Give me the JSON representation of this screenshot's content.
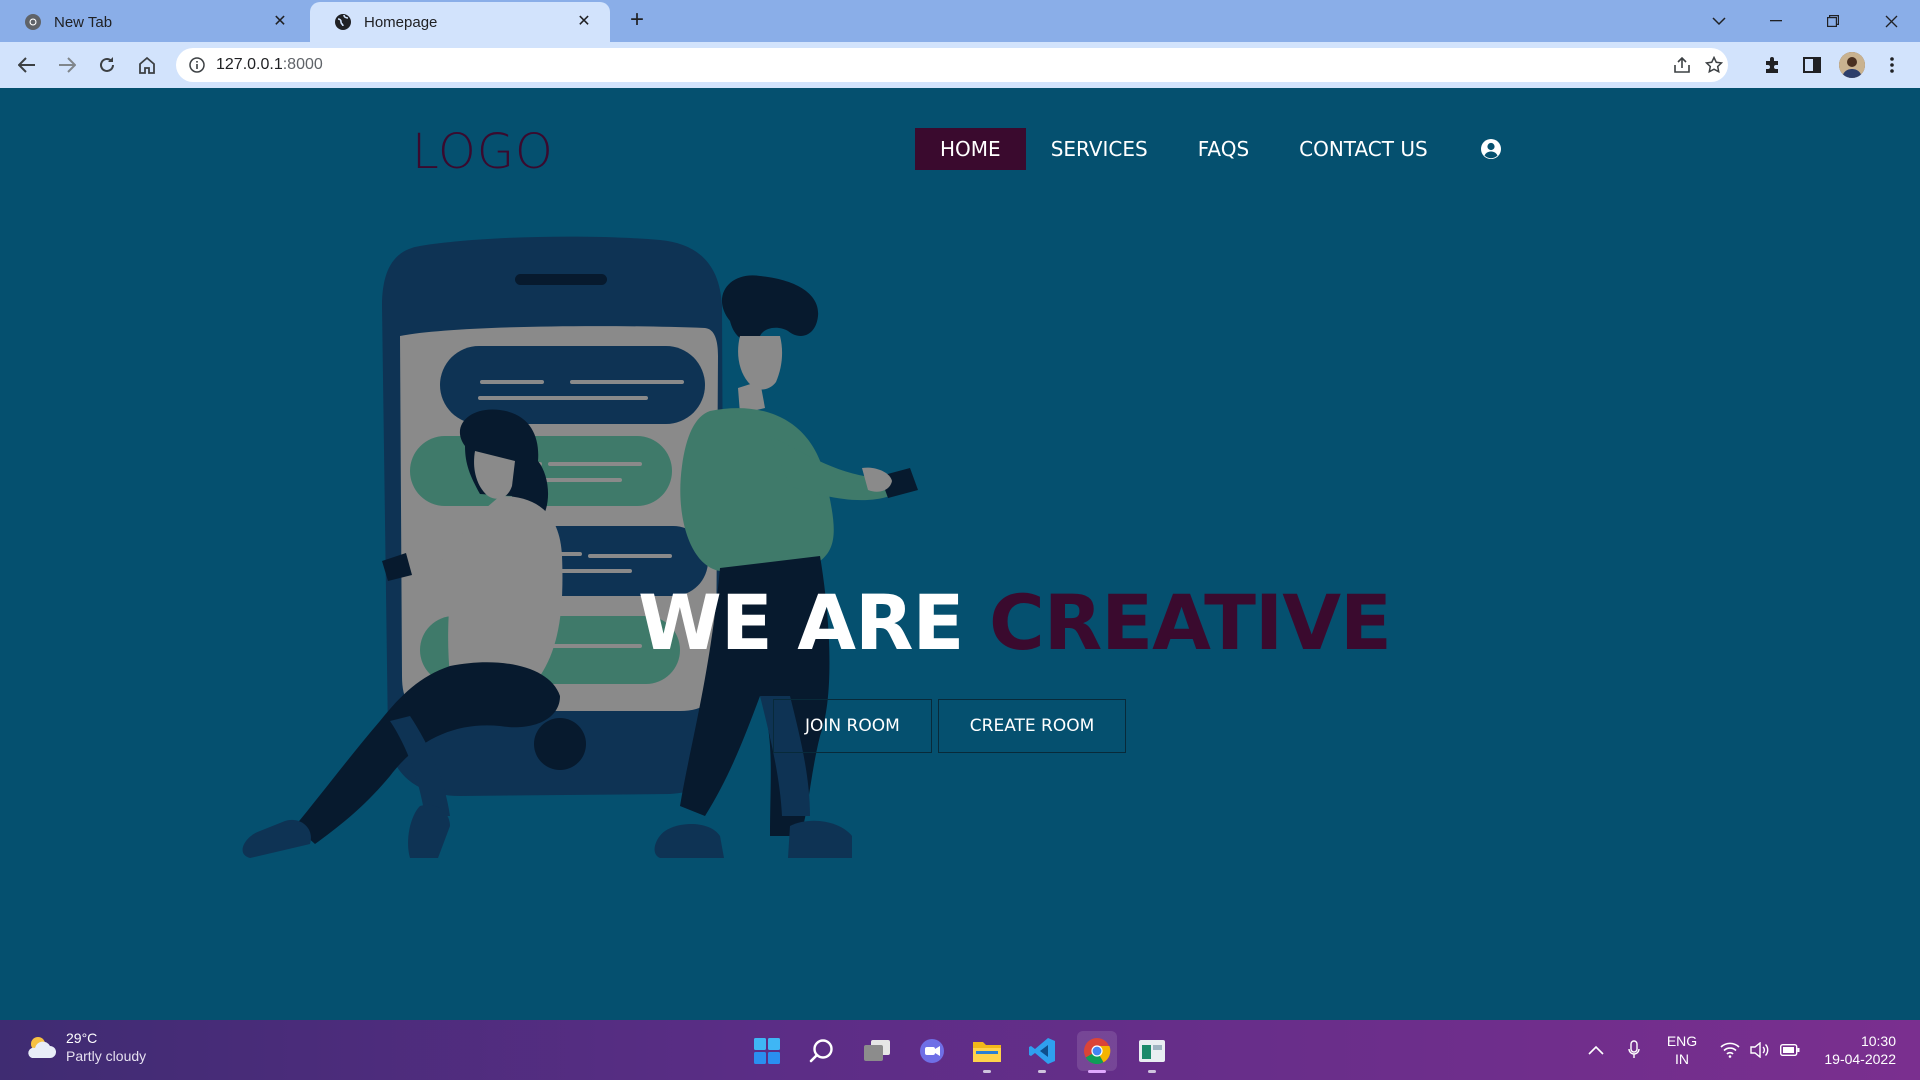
{
  "browser": {
    "tabs": [
      {
        "title": "New Tab"
      },
      {
        "title": "Homepage"
      }
    ],
    "url_host": "127.0.0.1",
    "url_port": ":8000"
  },
  "site": {
    "logo": "LOGO",
    "nav": [
      "HOME",
      "SERVICES",
      "FAQS",
      "CONTACT US"
    ],
    "hero_white": "WE ARE",
    "hero_accent": "CREATIVE",
    "buttons": {
      "join": "JOIN ROOM",
      "create": "CREATE ROOM"
    },
    "colors": {
      "background": "#05506f",
      "accent": "#3a0a2e"
    }
  },
  "taskbar": {
    "weather_temp": "29°C",
    "weather_desc": "Partly cloudy",
    "lang_1": "ENG",
    "lang_2": "IN",
    "time": "10:30",
    "date": "19-04-2022"
  }
}
